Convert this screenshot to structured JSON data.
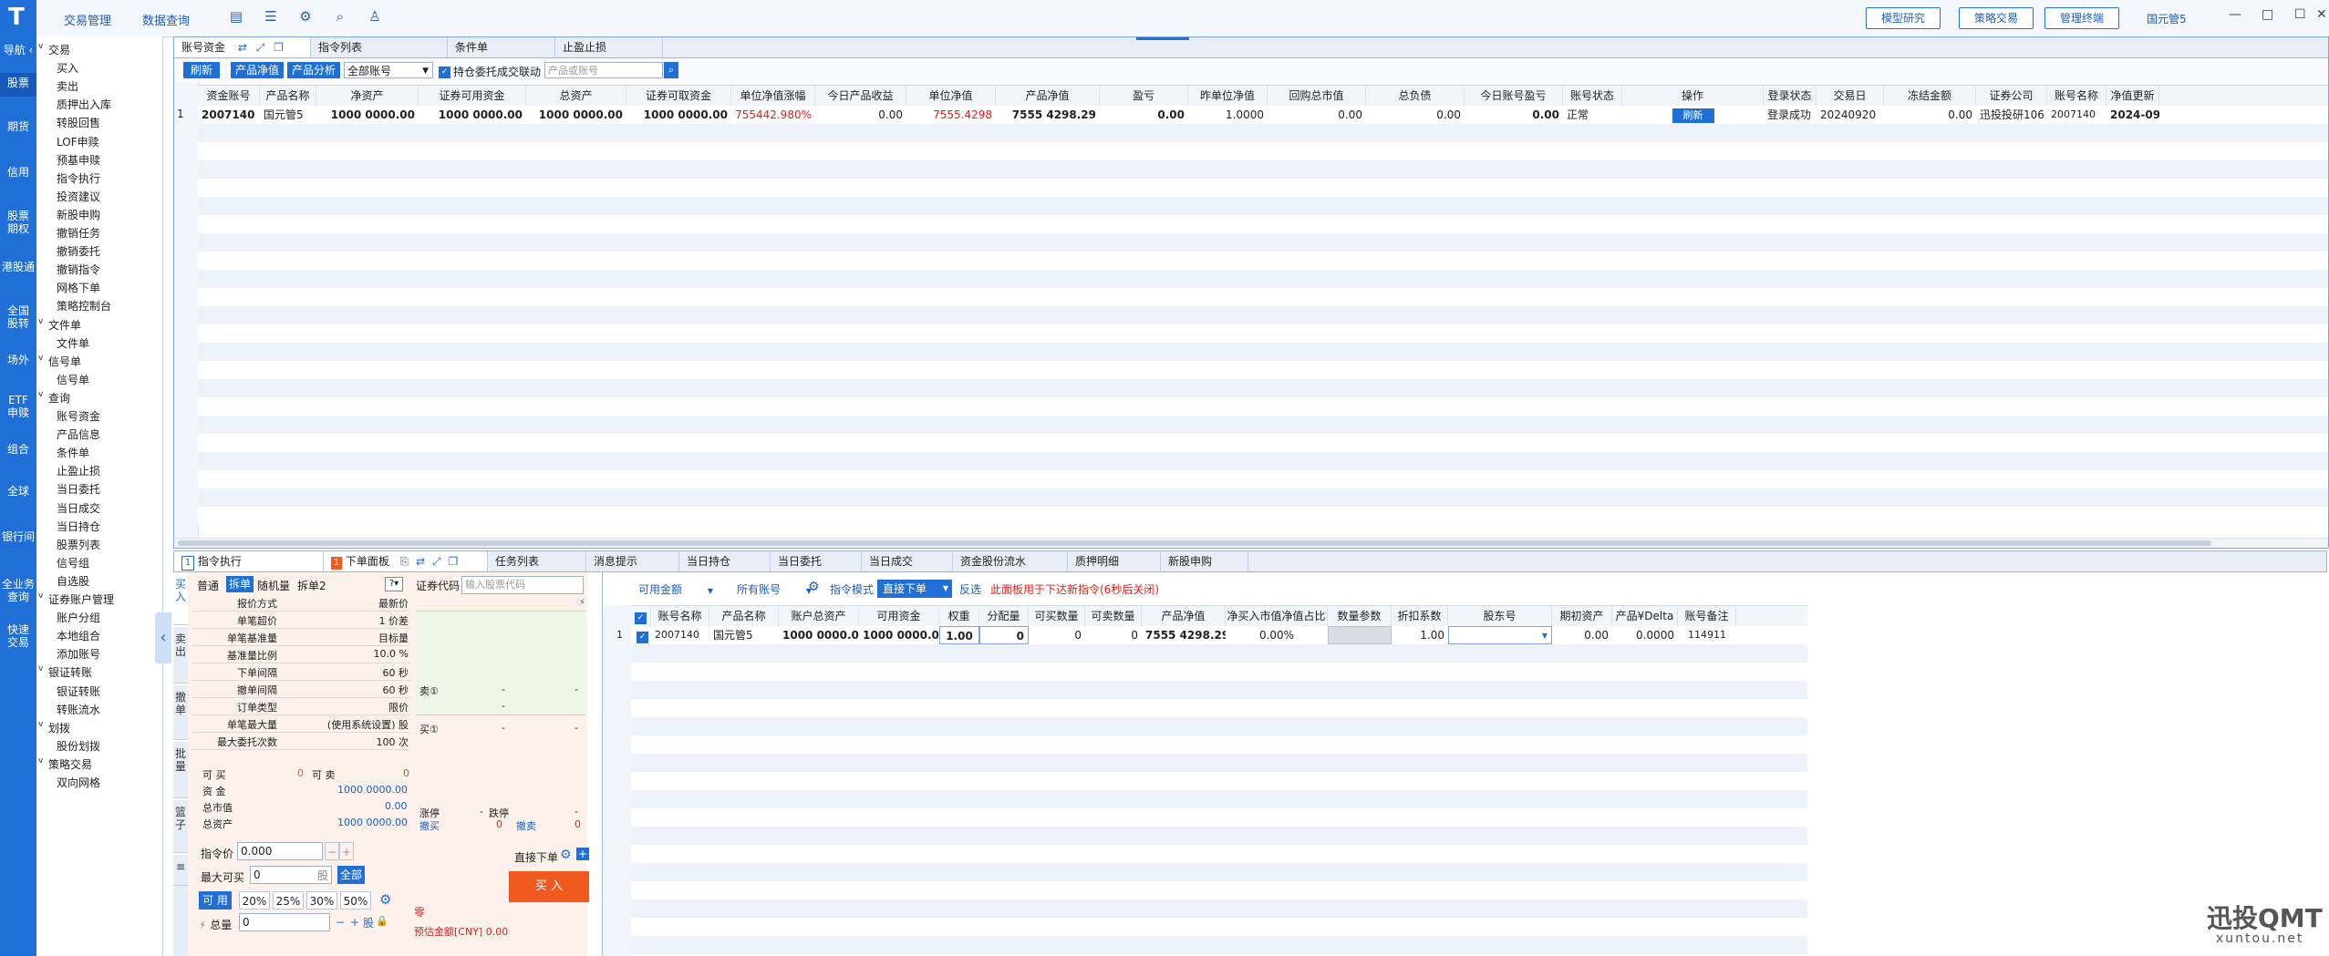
{
  "rail": {
    "logo": "T",
    "nav_label": "导航 ‹",
    "items": [
      {
        "label": "股票",
        "active": true
      },
      {
        "label": "期货"
      },
      {
        "label": "信用"
      },
      {
        "label": "股票\n期权"
      },
      {
        "label": "港股通"
      },
      {
        "label": "全国\n股转"
      },
      {
        "label": "场外"
      },
      {
        "label": "ETF\n申赎"
      },
      {
        "label": "组合"
      },
      {
        "label": "全球"
      },
      {
        "label": "银行间"
      },
      {
        "label": "全业务\n查询"
      },
      {
        "label": "快速\n交易"
      }
    ]
  },
  "tree": [
    {
      "type": "g",
      "label": "交易"
    },
    {
      "type": "c",
      "label": "买入"
    },
    {
      "type": "c",
      "label": "卖出"
    },
    {
      "type": "c",
      "label": "质押出入库"
    },
    {
      "type": "c",
      "label": "转股回售"
    },
    {
      "type": "c",
      "label": "LOF申赎"
    },
    {
      "type": "c",
      "label": "预基申赎"
    },
    {
      "type": "c",
      "label": "指令执行"
    },
    {
      "type": "c",
      "label": "投资建议"
    },
    {
      "type": "c",
      "label": "新股申购"
    },
    {
      "type": "c",
      "label": "撤销任务"
    },
    {
      "type": "c",
      "label": "撤销委托"
    },
    {
      "type": "c",
      "label": "撤销指令"
    },
    {
      "type": "c",
      "label": "网格下单"
    },
    {
      "type": "c",
      "label": "策略控制台"
    },
    {
      "type": "g",
      "label": "文件单"
    },
    {
      "type": "c",
      "label": "文件单"
    },
    {
      "type": "g",
      "label": "信号单"
    },
    {
      "type": "c",
      "label": "信号单"
    },
    {
      "type": "g",
      "label": "查询"
    },
    {
      "type": "c",
      "label": "账号资金"
    },
    {
      "type": "c",
      "label": "产品信息"
    },
    {
      "type": "c",
      "label": "条件单"
    },
    {
      "type": "c",
      "label": "止盈止损"
    },
    {
      "type": "c",
      "label": "当日委托"
    },
    {
      "type": "c",
      "label": "当日成交"
    },
    {
      "type": "c",
      "label": "当日持仓"
    },
    {
      "type": "c",
      "label": "股票列表"
    },
    {
      "type": "c",
      "label": "信号组"
    },
    {
      "type": "c",
      "label": "自选股"
    },
    {
      "type": "g",
      "label": "证券账户管理"
    },
    {
      "type": "c",
      "label": "账户分组"
    },
    {
      "type": "c",
      "label": "本地组合"
    },
    {
      "type": "c",
      "label": "添加账号"
    },
    {
      "type": "g",
      "label": "银证转账"
    },
    {
      "type": "c",
      "label": "银证转账"
    },
    {
      "type": "c",
      "label": "转账流水"
    },
    {
      "type": "g",
      "label": "划拨"
    },
    {
      "type": "c",
      "label": "股份划拨"
    },
    {
      "type": "g",
      "label": "策略交易"
    },
    {
      "type": "c",
      "label": "双向网格"
    }
  ],
  "topbar": {
    "menu": [
      "交易管理",
      "数据查询"
    ],
    "buttons": [
      "模型研究",
      "策略交易",
      "管理终端"
    ],
    "user": "国元管5",
    "win": [
      "—",
      "□",
      "☐",
      "✕"
    ]
  },
  "top_panel": {
    "tabs": [
      "账号资金",
      "指令列表",
      "条件单",
      "止盈止损"
    ],
    "toolbar": {
      "refresh": "刷新",
      "product_net": "产品净值",
      "product_analysis": "产品分析",
      "account_select": "全部账号",
      "link_label": "持仓委托成交联动",
      "search_placeholder": "产品或账号"
    },
    "columns": [
      "资金账号",
      "产品名称",
      "净资产",
      "证券可用资金",
      "总资产",
      "证券可取资金",
      "单位净值涨幅",
      "今日产品收益",
      "单位净值",
      "产品净值",
      "盈亏",
      "昨单位净值",
      "回购总市值",
      "总负债",
      "今日账号盈亏",
      "账号状态",
      "操作",
      "登录状态",
      "交易日",
      "冻结金额",
      "证券公司",
      "账号名称",
      "净值更新"
    ],
    "row": {
      "idx": "1",
      "cells": [
        "2007140",
        "国元管5",
        "1000 0000.00",
        "1000 0000.00",
        "1000 0000.00",
        "1000 0000.00",
        "755442.980%",
        "0.00",
        "7555.4298",
        "7555 4298.29",
        "0.00",
        "1.0000",
        "0.00",
        "0.00",
        "0.00",
        "正常",
        "刷新",
        "登录成功",
        "20240920",
        "0.00",
        "迅投投研106",
        "2007140",
        "2024-09-20"
      ]
    }
  },
  "bottom_tabs": {
    "left": [
      {
        "badge": "1",
        "label": "指令执行"
      },
      {
        "badge": "1",
        "label": "下单面板"
      }
    ],
    "right": [
      "任务列表",
      "消息提示",
      "当日持仓",
      "当日委托",
      "当日成交",
      "资金股份流水",
      "质押明细",
      "新股申购"
    ]
  },
  "order_panel": {
    "vtabs": [
      "买入",
      "卖出",
      "撤单",
      "批量",
      "篮子",
      "≡"
    ],
    "modes": [
      "普通",
      "拆单",
      "随机量",
      "拆单2"
    ],
    "params": [
      {
        "k": "报价方式",
        "v": "最新价"
      },
      {
        "k": "单笔超价",
        "v": "1 价差"
      },
      {
        "k": "单笔基准量",
        "v": "目标量"
      },
      {
        "k": "基准量比例",
        "v": "10.0 %"
      },
      {
        "k": "下单间隔",
        "v": "60 秒"
      },
      {
        "k": "撤单间隔",
        "v": "60 秒"
      },
      {
        "k": "订单类型",
        "v": "限价"
      },
      {
        "k": "单笔最大量",
        "v": "(使用系统设置) 股"
      },
      {
        "k": "最大委托次数",
        "v": "100 次"
      }
    ],
    "stock_code_label": "证券代码",
    "stock_code_placeholder": "输入股票代码",
    "sell1": "卖①",
    "buy1": "买①",
    "dash": "-",
    "limit_up": "涨停",
    "limit_down": "跌停",
    "buy_cancel": "撤买",
    "sell_cancel": "撤卖",
    "zero": "0",
    "can_buy_label": "可 买",
    "can_buy": "0",
    "can_sell_label": "可 卖",
    "can_sell": "0",
    "funds_label": "资 金",
    "funds": "1000 0000.00",
    "mkt_label": "总市值",
    "mkt": "0.00",
    "assets_label": "总资产",
    "assets": "1000 0000.00",
    "price_label": "指令价",
    "price_value": "0.000",
    "max_buy_label": "最大可买",
    "max_buy_value": "0",
    "unit": "股",
    "all_btn": "全部",
    "avail_btn": "可 用",
    "pcts": [
      "20%",
      "25%",
      "30%",
      "50%"
    ],
    "total_label": "总量",
    "total_value": "0",
    "direct_label": "直接下单",
    "buy_button": "买 入",
    "zero_note": "零",
    "estimate": "预估金额[CNY] 0.00"
  },
  "right_panel": {
    "avail_funds": "可用金额",
    "all_accounts": "所有账号",
    "instr_mode": "指令模式",
    "direct": "直接下单",
    "reverse": "反选",
    "note": "此面板用于下达新指令(6秒后关闭)",
    "columns": [
      "账号名称",
      "产品名称",
      "账户总资产",
      "可用资金",
      "权重",
      "分配量",
      "可买数量",
      "可卖数量",
      "产品净值",
      "净买入市值净值占比",
      "数量参数",
      "折扣系数",
      "股东号",
      "期初资产",
      "产品¥Delta",
      "账号备注"
    ],
    "row": {
      "idx": "1",
      "cells": [
        "2007140",
        "国元管5",
        "1000 0000.00",
        "1000 0000.00",
        "1.00",
        "0",
        "0",
        "0",
        "7555 4298.29",
        "0.00%",
        "",
        "1.00",
        "",
        "0.00",
        "0.0000",
        "114911"
      ]
    }
  },
  "watermark": {
    "main": "迅投QMT",
    "sub": "xuntou.net"
  },
  "colors": {
    "brand": "#1f6fd6",
    "positive": "#e0201a",
    "buy_button": "#f05a1e"
  }
}
